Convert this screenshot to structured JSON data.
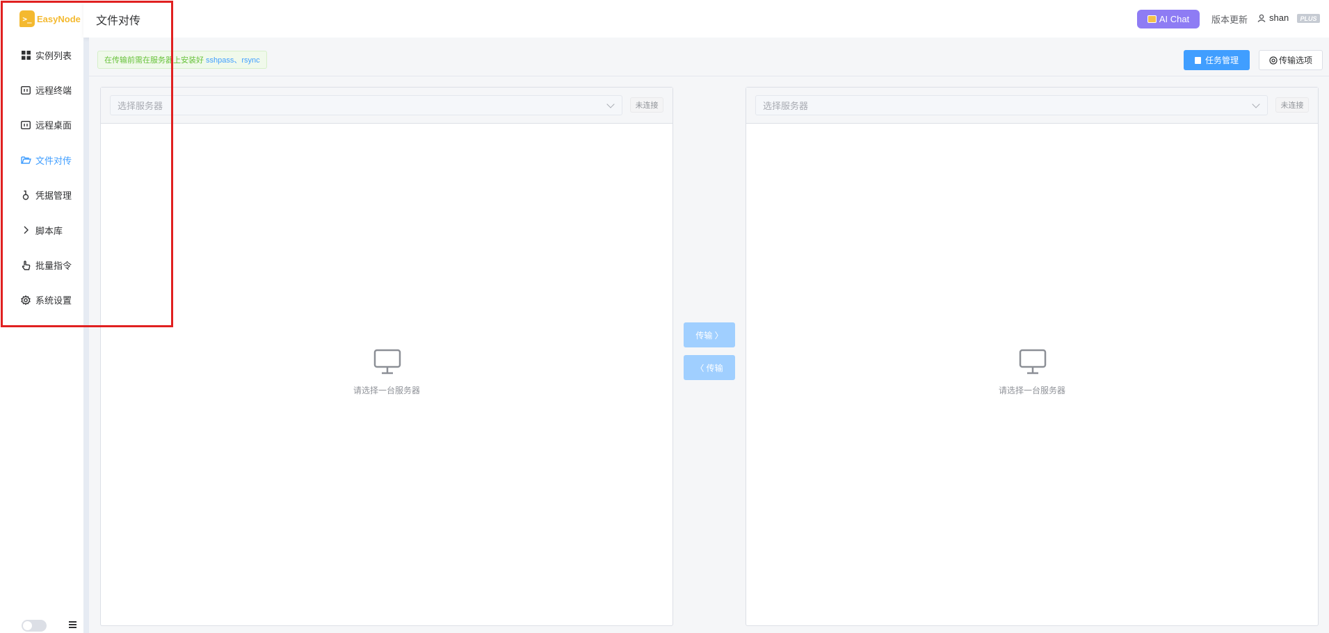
{
  "app": {
    "logo_text": "EasyNode",
    "logo_glyph": ">_"
  },
  "sidebar": {
    "items": [
      {
        "label": "实例列表",
        "icon": "grid-icon"
      },
      {
        "label": "远程终端",
        "icon": "terminal-icon"
      },
      {
        "label": "远程桌面",
        "icon": "desktop-icon"
      },
      {
        "label": "文件对传",
        "icon": "folder-open-icon",
        "active": true
      },
      {
        "label": "凭据管理",
        "icon": "key-icon"
      },
      {
        "label": "脚本库",
        "icon": "chevron-right-icon"
      },
      {
        "label": "批量指令",
        "icon": "pointer-hand-icon"
      },
      {
        "label": "系统设置",
        "icon": "gear-icon"
      }
    ]
  },
  "header": {
    "title": "文件对传",
    "ai_chat_label": "AI Chat",
    "version_label": "版本更新",
    "username": "shan",
    "plan_badge": "PLUS"
  },
  "toolbar": {
    "tip_text": "在传输前需在服务器上安装好",
    "tip_tools": "sshpass、rsync",
    "task_button": "任务管理",
    "options_button": "传输选项"
  },
  "panels": {
    "left": {
      "placeholder": "选择服务器",
      "status": "未连接",
      "empty_text": "请选择一台服务器"
    },
    "right": {
      "placeholder": "选择服务器",
      "status": "未连接",
      "empty_text": "请选择一台服务器"
    }
  },
  "transfer": {
    "to_right": "传输 〉",
    "to_left": "〈 传输"
  },
  "colors": {
    "primary": "#409eff",
    "ai_chat": "#8e7cf4",
    "logo": "#f4b92f",
    "tip_green": "#67c23a",
    "highlight_red": "#e02020"
  }
}
